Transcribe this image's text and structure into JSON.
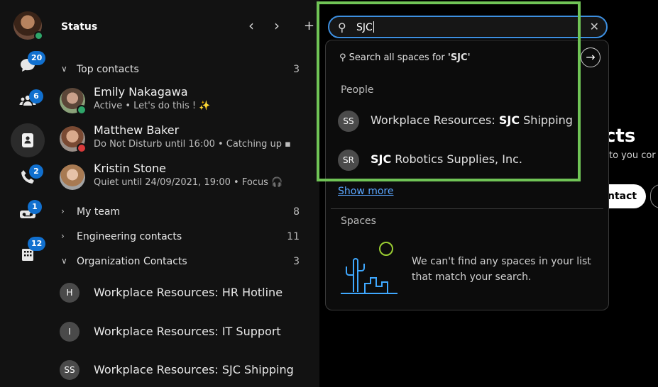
{
  "rail": {
    "items": [
      {
        "name": "messaging",
        "badge": "20"
      },
      {
        "name": "teams",
        "badge": "6"
      },
      {
        "name": "contacts",
        "badge": ""
      },
      {
        "name": "calling",
        "badge": "2"
      },
      {
        "name": "voicemail",
        "badge": "1"
      },
      {
        "name": "meetings",
        "badge": "12"
      }
    ]
  },
  "panel": {
    "title": "Status",
    "sections": {
      "top": {
        "label": "Top contacts",
        "count": "3"
      },
      "team": {
        "label": "My team",
        "count": "8"
      },
      "eng": {
        "label": "Engineering contacts",
        "count": "11"
      },
      "org": {
        "label": "Organization Contacts",
        "count": "3"
      }
    },
    "top_contacts": [
      {
        "name": "Emily Nakagawa",
        "status": "Active  •  Let's do this ! ✨"
      },
      {
        "name": "Matthew Baker",
        "status": "Do Not Disturb until 16:00  •  Catching up ▪"
      },
      {
        "name": "Kristin Stone",
        "status": "Quiet until 24/09/2021, 19:00  •  Focus 🎧"
      }
    ],
    "org_contacts": [
      {
        "initials": "H",
        "name": "Workplace Resources: HR Hotline"
      },
      {
        "initials": "I",
        "name": "Workplace Resources: IT Support"
      },
      {
        "initials": "SS",
        "name": "Workplace Resources: SJC Shipping"
      }
    ]
  },
  "search": {
    "value": "SJC",
    "search_all_prefix": "Search all spaces for ",
    "search_all_term": "'SJC'",
    "people_heading": "People",
    "people": [
      {
        "initials": "SS",
        "prefix": "Workplace Resources: ",
        "match": "SJC",
        "suffix": " Shipping"
      },
      {
        "initials": "SR",
        "prefix": "",
        "match": "SJC",
        "suffix": " Robotics Supplies, Inc."
      }
    ],
    "show_more": "Show more",
    "spaces_heading": "Spaces",
    "spaces_empty": "We can't find any spaces in your list that match your search."
  },
  "background": {
    "title_fragment": "cts",
    "sub_fragment": "to you cor",
    "button_fragment": "ntact"
  },
  "colors": {
    "accent": "#1170cf",
    "highlight": "#70c456",
    "active": "#2fa66a",
    "dnd": "#d93a3a"
  }
}
